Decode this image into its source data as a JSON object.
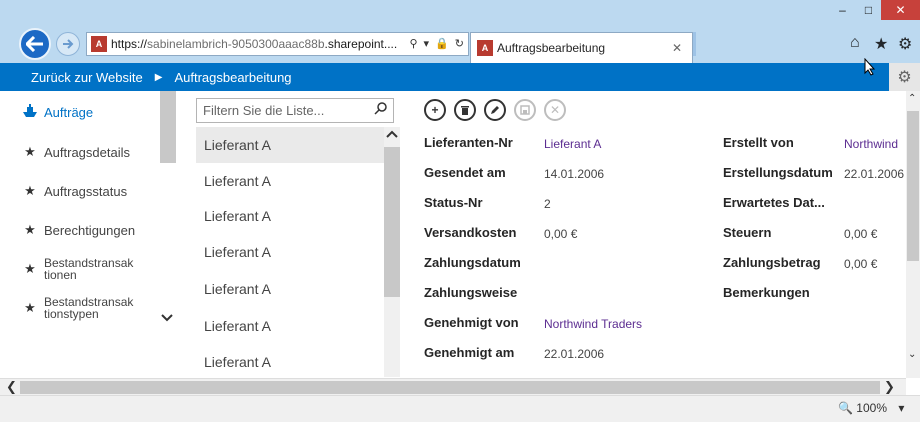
{
  "browser": {
    "url_prefix": "https://",
    "url_host": "sabinelambrich-9050300aaac88b",
    "url_rest": ".sharepoint....",
    "tab_title": "Auftragsbearbeitung"
  },
  "topbar": {
    "back_label": "Zurück zur Website",
    "app_title": "Auftragsbearbeitung"
  },
  "nav": {
    "items": [
      {
        "label": "Aufträge",
        "icon": "ship-icon"
      },
      {
        "label": "Auftragsdetails",
        "icon": "star-icon"
      },
      {
        "label": "Auftragsstatus",
        "icon": "star-icon"
      },
      {
        "label": "Berechtigungen",
        "icon": "star-icon"
      },
      {
        "label_1": "Bestandstransak",
        "label_2": "tionen",
        "icon": "star-icon"
      },
      {
        "label_1": "Bestandstransak",
        "label_2": "tionstypen",
        "icon": "star-icon"
      }
    ]
  },
  "list": {
    "filter_placeholder": "Filtern Sie die Liste...",
    "items": [
      "Lieferant A",
      "Lieferant A",
      "Lieferant A",
      "Lieferant A",
      "Lieferant A",
      "Lieferant A",
      "Lieferant A",
      "Lieferant A"
    ]
  },
  "detail": {
    "left": [
      {
        "label": "Lieferanten-Nr",
        "value": "Lieferant A",
        "link": true
      },
      {
        "label": "Gesendet am",
        "value": "14.01.2006",
        "link": false
      },
      {
        "label": "Status-Nr",
        "value": "2",
        "link": false
      },
      {
        "label": "Versandkosten",
        "value": "0,00 €",
        "link": false
      },
      {
        "label": "Zahlungsdatum",
        "value": "",
        "link": false
      },
      {
        "label": "Zahlungsweise",
        "value": "",
        "link": false
      },
      {
        "label": "Genehmigt von",
        "value": "Northwind Traders",
        "link": true
      },
      {
        "label": "Genehmigt am",
        "value": "22.01.2006",
        "link": false
      }
    ],
    "right": [
      {
        "label": "Erstellt von",
        "value": "Northwind",
        "link": true
      },
      {
        "label": "Erstellungsdatum",
        "value": "22.01.2006",
        "link": false
      },
      {
        "label": "Erwartetes Dat...",
        "value": "",
        "link": false
      },
      {
        "label": "Steuern",
        "value": "0,00 €",
        "link": false
      },
      {
        "label": "Zahlungsbetrag",
        "value": "0,00 €",
        "link": false
      },
      {
        "label": "Bemerkungen",
        "value": "",
        "link": false
      }
    ]
  },
  "status": {
    "zoom": "100%"
  },
  "colors": {
    "accent": "#0072c6",
    "link": "#5c2d91"
  }
}
